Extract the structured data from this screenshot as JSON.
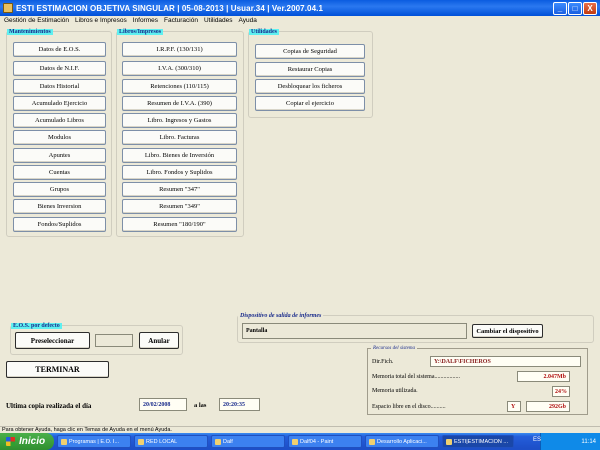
{
  "window": {
    "title": "ESTI ESTIMACION OBJETIVA SINGULAR | 05-08-2013 | Usuar.34 | Ver.2007.04.1",
    "min": "_",
    "max": "□",
    "close": "X"
  },
  "menu": [
    "Gestión de Estimación",
    "Libros e Impresos",
    "Informes",
    "Facturación",
    "Utilidades",
    "Ayuda"
  ],
  "mantenimientos": {
    "title": "Mantenimientos",
    "buttons": [
      "Datos de E.O.S.",
      "Datos de N.I.F.",
      "Datos Historial",
      "Acumulado Ejercicio",
      "Acumulado Libros",
      "Modulos",
      "Apuntes",
      "Cuentas",
      "Grupos",
      "Bienes Inversion",
      "Fondos/Suplidos"
    ]
  },
  "libros": {
    "title": "Libros/Impresos",
    "buttons": [
      "I.R.P.F. (130/131)",
      "I.V.A. (300/310)",
      "Retenciones (110/115)",
      "Resumen de I.V.A. (390)",
      "Libro. Ingresos y Gastos",
      "Libro. Facturas",
      "Libro. Bienes de Inversión",
      "Libro. Fondos y Suplidos",
      "Resumen \"347\"",
      "Resumen \"349\"",
      "Resumen \"180/190\""
    ]
  },
  "utilidades": {
    "title": "Utilidades",
    "buttons": [
      "Copias de Seguridad",
      "Restaurar Copias",
      "Desbloquear los ficheros",
      "Copiar el ejercicio"
    ]
  },
  "eos": {
    "title": "E.O.S. por defecto",
    "preseleccionar": "Preseleccionar",
    "value": "",
    "anular": "Anular"
  },
  "terminar": "TERMINAR",
  "dispositivo": {
    "title": "Dispositivo de salida de informes",
    "value": "Pantalla",
    "cambiar": "Cambiar el dispositivo"
  },
  "sistema": {
    "title": "Recursos del sistema",
    "dir_label": "Dir.Fich.",
    "dir_value": "Y:\\DALF\\FICHEROS",
    "mem_total_label": "Memoria total del sistema.................",
    "mem_total_value": "2.047Mb",
    "mem_used_label": "Memoria utilizada.",
    "mem_used_value": "24%",
    "disk_label": "Espacio libre en el disco..........",
    "disk_drive": "Y",
    "disk_value": "292Gb"
  },
  "backup": {
    "label": "Ultima copia realizada el día",
    "date": "20/02/2008",
    "a_las": "a las",
    "time": "20:20:35"
  },
  "statusbar": "Para obtener Ayuda, haga clic en Temas de Ayuda en el menú Ayuda.",
  "taskbar": {
    "start": "Inicio",
    "tasks": [
      "Programas | E.O. I...",
      "RED LOCAL",
      "Dalf",
      "Dalf04 - Paint",
      "Desarrollo Aplicaci...",
      "ESTI|ESTIMACION ..."
    ],
    "lang": "ES",
    "clock": "11:14"
  }
}
